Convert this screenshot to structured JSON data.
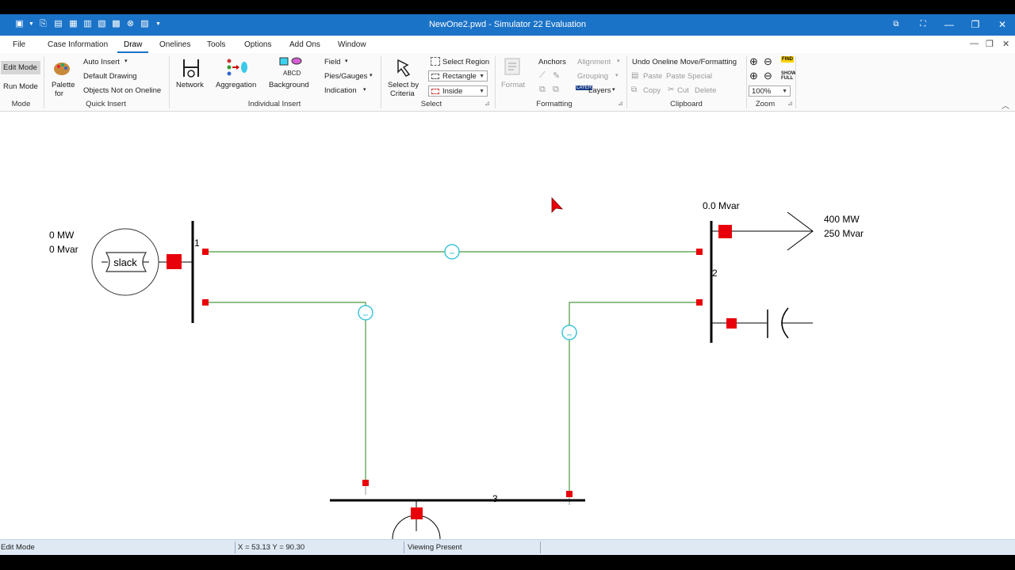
{
  "window": {
    "title": "NewOne2.pwd - Simulator 22 Evaluation",
    "controls": {
      "restore_down_icon": "restore-icon",
      "fullscreen_icon": "fullscreen-icon",
      "minimize": "—",
      "maximize": "❐",
      "close": "✕"
    }
  },
  "menu": {
    "items": [
      "File",
      "Case Information",
      "Draw",
      "Onelines",
      "Tools",
      "Options",
      "Add Ons",
      "Window"
    ],
    "active": "Draw",
    "mdi_controls": [
      "—",
      "❐",
      "✕"
    ]
  },
  "ribbon": {
    "mode": {
      "edit": "Edit Mode",
      "run": "Run Mode",
      "group": "Mode"
    },
    "quick_insert": {
      "palette_line1": "Palette",
      "palette_line2": "for",
      "auto_insert": "Auto Insert",
      "default_drawing": "Default Drawing",
      "objects_not_on_oneline": "Objects Not on Oneline",
      "group": "Quick Insert"
    },
    "individual_insert": {
      "network": "Network",
      "aggregation": "Aggregation",
      "background": "Background",
      "field": "Field",
      "pies_gauges": "Pies/Gauges",
      "indication": "Indication",
      "group": "Individual Insert"
    },
    "select": {
      "select_by_line1": "Select by",
      "select_by_line2": "Criteria",
      "select_region": "Select Region",
      "shape_value": "Rectangle",
      "mode_value": "Inside",
      "group": "Select"
    },
    "formatting": {
      "format": "Format",
      "anchors": "Anchors",
      "alignment": "Alignment",
      "grouping": "Grouping",
      "layers": "Layers",
      "group": "Formatting"
    },
    "clipboard": {
      "undo": "Undo Oneline Move/Formatting",
      "paste": "Paste",
      "paste_special": "Paste Special",
      "copy": "Copy",
      "cut": "Cut",
      "delete": "Delete",
      "group": "Clipboard"
    },
    "zoom": {
      "value": "100%",
      "find": "FIND",
      "show_full_1": "SHOW",
      "show_full_2": "FULL",
      "group": "Zoom"
    }
  },
  "oneline": {
    "gen1": {
      "mw": "0 MW",
      "mvar": "0 Mvar",
      "label": "slack"
    },
    "bus1": "1",
    "bus2": "2",
    "bus3": "3",
    "gen2_mvar": "0.0 Mvar",
    "load": {
      "mw": "400 MW",
      "mvar": "250 Mvar"
    },
    "colors": {
      "line": "#4b9a3c",
      "breaker": "#e8000a",
      "bus": "#000000",
      "flow_circle": "#3cc4d8"
    }
  },
  "status": {
    "mode": "Edit Mode",
    "coords": "X = 53.13 Y = 90.30",
    "viewing": "Viewing Present"
  }
}
